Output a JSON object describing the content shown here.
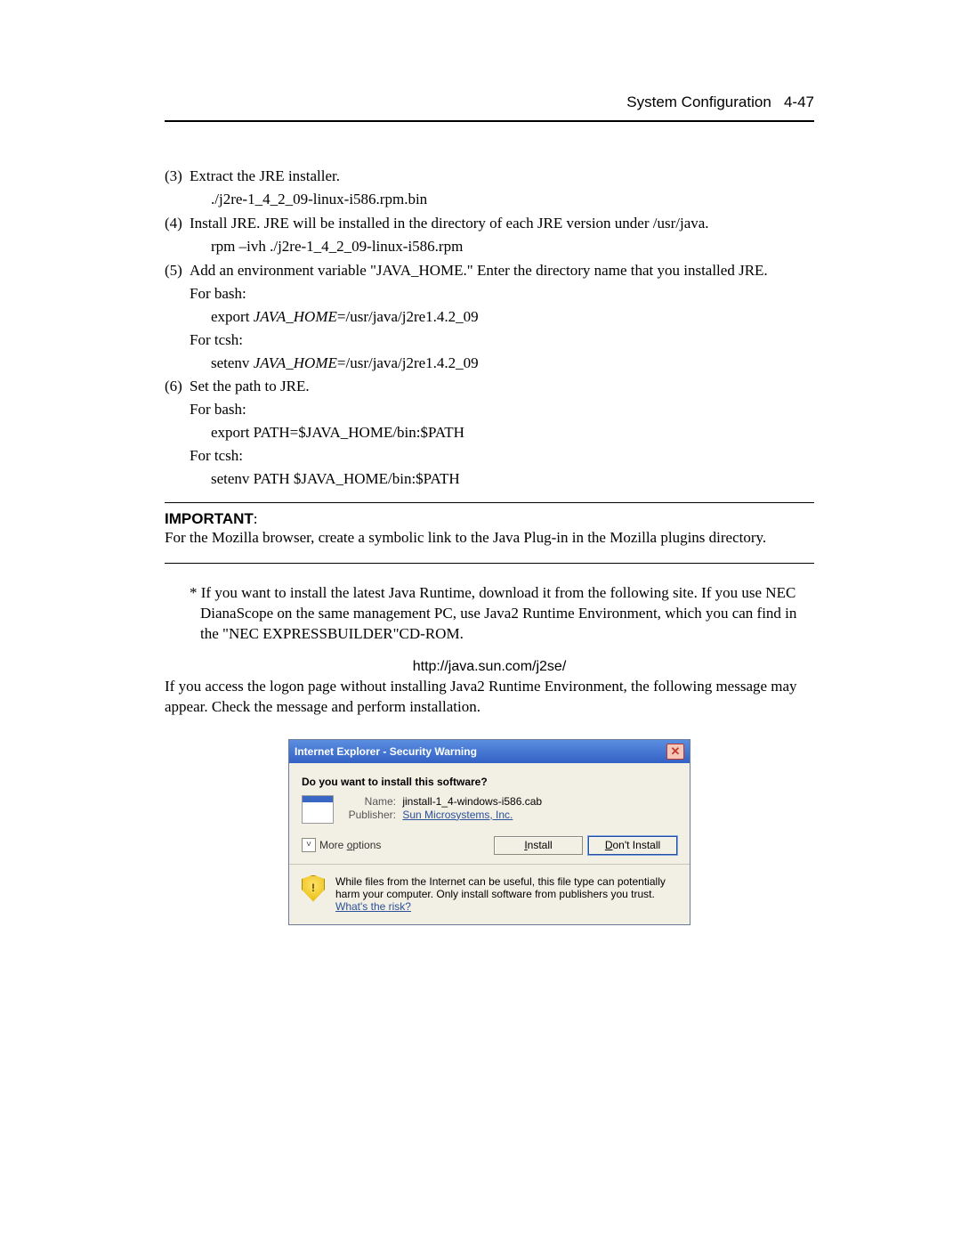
{
  "header": {
    "section": "System Configuration",
    "page": "4-47"
  },
  "steps": {
    "s3": {
      "marker": "(3)",
      "text": "Extract the JRE installer.",
      "cmd": "./j2re-1_4_2_09-linux-i586.rpm.bin"
    },
    "s4": {
      "marker": "(4)",
      "text": "Install JRE. JRE will be installed in the directory of each JRE version under /usr/java.",
      "cmd": "rpm –ivh ./j2re-1_4_2_09-linux-i586.rpm"
    },
    "s5": {
      "marker": "(5)",
      "text": "Add an environment variable \"JAVA_HOME.\" Enter the directory name that you installed JRE.",
      "bash_label": "For bash:",
      "bash_cmd_prefix": "export ",
      "bash_cmd_var": "JAVA_HOME",
      "bash_cmd_suffix": "=/usr/java/j2re1.4.2_09",
      "tcsh_label": "For tcsh:",
      "tcsh_cmd_prefix": "setenv ",
      "tcsh_cmd_var": "JAVA_HOME",
      "tcsh_cmd_suffix": "=/usr/java/j2re1.4.2_09"
    },
    "s6": {
      "marker": "(6)",
      "text": "Set the path to JRE.",
      "bash_label": "For bash:",
      "bash_cmd": "export PATH=$JAVA_HOME/bin:$PATH",
      "tcsh_label": "For tcsh:",
      "tcsh_cmd": "setenv PATH $JAVA_HOME/bin:$PATH"
    }
  },
  "important": {
    "label": "IMPORTANT",
    "colon": ":",
    "body": "For the Mozilla browser, create a symbolic link to the Java Plug-in in the Mozilla plugins directory."
  },
  "star_note": "* If you want to install the latest Java Runtime, download it from the following site. If you use NEC DianaScope on the same management PC, use Java2 Runtime Environment, which you can find in the \"NEC EXPRESSBUILDER\"CD-ROM.",
  "url": "http://java.sun.com/j2se/",
  "final_note": "If you access the logon page without installing Java2 Runtime Environment, the following message may appear. Check the message and perform installation.",
  "dialog": {
    "title": "Internet Explorer - Security Warning",
    "question": "Do you want to install this software?",
    "name_label": "Name:",
    "name_value": "jinstall-1_4-windows-i586.cab",
    "pub_label": "Publisher:",
    "pub_value": "Sun Microsystems, Inc.",
    "more_options": "More options",
    "install": "Install",
    "dont_install": "Don't Install",
    "foot_text": "While files from the Internet can be useful, this file type can potentially harm your computer. Only install software from publishers you trust. ",
    "risk_link": "What's the risk?"
  }
}
